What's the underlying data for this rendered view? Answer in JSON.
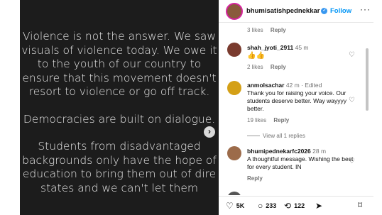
{
  "post": {
    "lines": [
      "Violence is not the answer. We saw visuals of violence today. We owe it to the youth of our country to ensure that this movement doesn't resort to violence or go off track.",
      "Democracies are built on dialogue.",
      "Students from disadvantaged backgrounds only have the hope of education to bring them out of dire states and we can't let them"
    ],
    "next_glyph": "›"
  },
  "header": {
    "username": "bhumisatishpednekkar",
    "verified_glyph": "✓",
    "follow": "Follow",
    "more": "···"
  },
  "comments": {
    "top_meta": {
      "likes": "3 likes",
      "reply": "Reply"
    },
    "items": [
      {
        "user": "shah_jyoti_2911",
        "time": "45 m",
        "text": "👍👍",
        "likes": "2 likes",
        "reply": "Reply",
        "avatar_color": "#7a3b2e"
      },
      {
        "user": "anmolsachar",
        "time": "42 m · Edited",
        "text": "Thank you for raising your voice. Our students deserve better. Way wayyyy better.",
        "likes": "19 likes",
        "reply": "Reply",
        "view_replies": "View all 1 replies",
        "avatar_color": "#d4a017"
      },
      {
        "user": "bhumipednekarfc2026",
        "time": "28 m",
        "text": "A thoughtful message. Wishing the best for every student. IN",
        "reply": "Reply",
        "avatar_color": "#9c6b4a"
      }
    ],
    "heart_glyph": "♡"
  },
  "actions": {
    "likes": "5K",
    "comments": "233",
    "reposts": "122",
    "like_icon": "heart-icon",
    "comment_icon": "comment-icon",
    "repost_icon": "repost-icon",
    "share_icon": "share-icon",
    "bookmark_icon": "bookmark-icon"
  }
}
